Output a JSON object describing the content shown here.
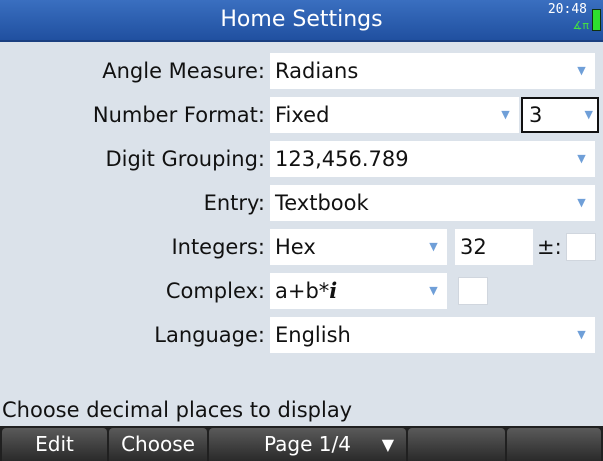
{
  "header": {
    "title": "Home Settings",
    "clock": "20:48",
    "angle_indicator": "∡π",
    "battery_color": "#2ee02e"
  },
  "settings": {
    "angle_measure": {
      "label": "Angle Measure:",
      "value": "Radians"
    },
    "number_format": {
      "label": "Number Format:",
      "value": "Fixed",
      "places": "3"
    },
    "digit_grouping": {
      "label": "Digit Grouping:",
      "value": "123,456.789"
    },
    "entry": {
      "label": "Entry:",
      "value": "Textbook"
    },
    "integers": {
      "label": "Integers:",
      "value": "Hex",
      "bits": "32",
      "signed_label": "±:",
      "signed_checked": false
    },
    "complex": {
      "label": "Complex:",
      "value_plain": "a+b*",
      "value_italic": "i",
      "checked": false
    },
    "language": {
      "label": "Language:",
      "value": "English"
    }
  },
  "help_text": "Choose decimal places to display",
  "menu": {
    "edit": "Edit",
    "choose": "Choose",
    "page": "Page 1/4",
    "page_pin": "▼"
  },
  "icons": {
    "dropdown_arrow": "▼"
  },
  "colors": {
    "titlebar": "#2a5cb0",
    "background": "#dbe2ea",
    "accent_arrow": "#6f9fd8"
  }
}
